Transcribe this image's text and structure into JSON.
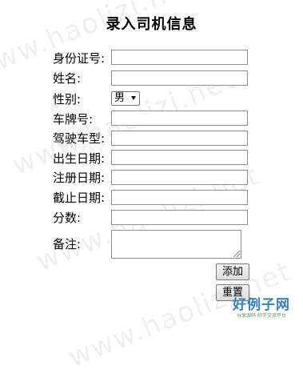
{
  "watermark": "www.haolizi.net",
  "title": "录入司机信息",
  "form": {
    "id_label": "身份证号:",
    "id_value": "",
    "name_label": "姓名:",
    "name_value": "",
    "gender_label": "性别:",
    "gender_selected": "男",
    "plate_label": "车牌号:",
    "plate_value": "",
    "vehicle_type_label": "驾驶车型:",
    "vehicle_type_value": "",
    "birth_label": "出生日期:",
    "birth_value": "",
    "register_label": "注册日期:",
    "register_value": "",
    "expiry_label": "截止日期:",
    "expiry_value": "",
    "score_label": "分数:",
    "score_value": "",
    "remark_label": "备注:",
    "remark_value": ""
  },
  "buttons": {
    "add": "添加",
    "reset": "重置"
  },
  "logo": {
    "text": "好例子网",
    "subtext": "分享源码 好学交流平台"
  },
  "colors": {
    "logo": "#2f7fcf"
  }
}
